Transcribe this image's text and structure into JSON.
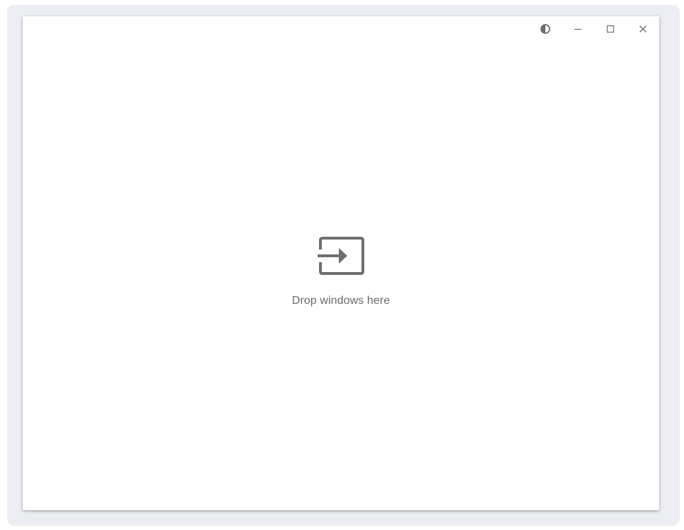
{
  "window": {
    "caption_buttons": [
      {
        "name": "theme-toggle",
        "icon": "half-circle-icon"
      },
      {
        "name": "minimize",
        "icon": "minimize-icon"
      },
      {
        "name": "maximize",
        "icon": "maximize-icon"
      },
      {
        "name": "close",
        "icon": "close-icon"
      }
    ],
    "icon_color": "#6e6e6e"
  },
  "drop_zone": {
    "icon": "drop-input-icon",
    "label": "Drop windows here"
  }
}
